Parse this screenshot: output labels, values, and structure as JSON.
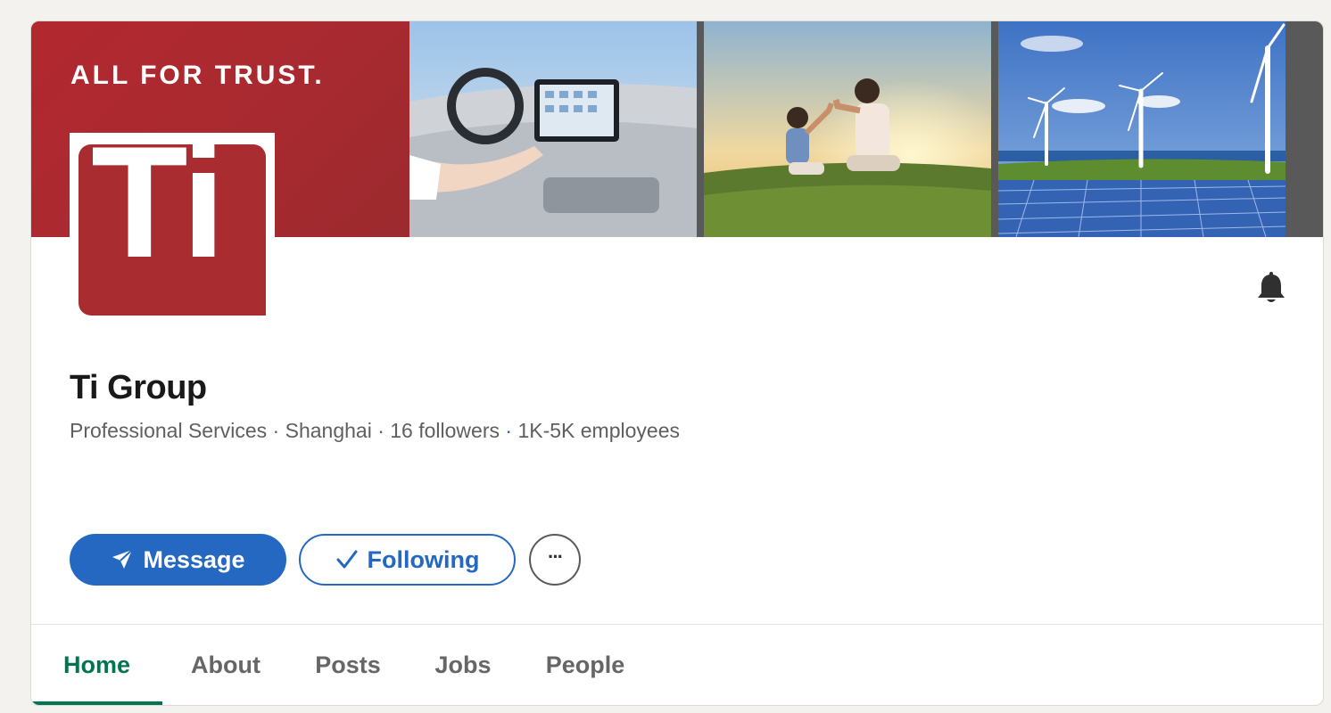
{
  "banner": {
    "slogan": "ALL FOR TRUST."
  },
  "logo": {
    "text": "Ti"
  },
  "company": {
    "name": "Ti Group",
    "industry": "Professional Services",
    "location": "Shanghai",
    "followers": "16 followers",
    "employees": "1K-5K employees",
    "separator": " · "
  },
  "actions": {
    "message_label": "Message",
    "following_label": "Following",
    "more_label": "···"
  },
  "tabs": [
    {
      "label": "Home",
      "active": true
    },
    {
      "label": "About",
      "active": false
    },
    {
      "label": "Posts",
      "active": false
    },
    {
      "label": "Jobs",
      "active": false
    },
    {
      "label": "People",
      "active": false
    }
  ],
  "colors": {
    "brand_red": "#a82c30",
    "primary_blue": "#2468c2",
    "active_tab_green": "#01754f",
    "page_background": "#f4f2ee"
  },
  "icons": {
    "notification": "bell-icon",
    "message": "send-icon",
    "following": "checkmark-icon",
    "more": "more-horizontal-icon"
  }
}
